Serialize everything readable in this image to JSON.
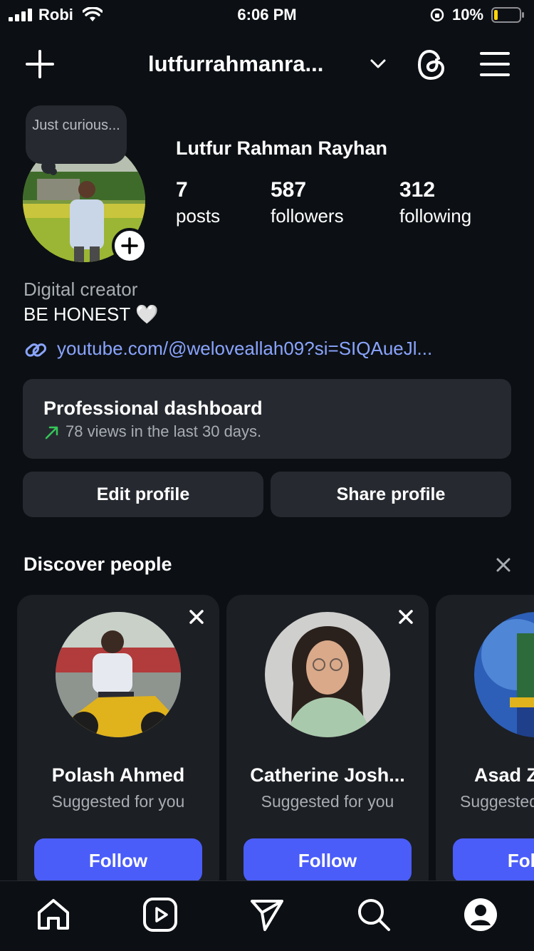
{
  "status_bar": {
    "carrier": "Robi",
    "time": "6:06 PM",
    "battery": "10%"
  },
  "header": {
    "username": "lutfurrahmanra...",
    "new_post_icon": "plus-icon",
    "threads_icon": "threads-icon",
    "menu_icon": "hamburger-menu-icon"
  },
  "profile": {
    "note": "Just curious...",
    "display_name": "Lutfur Rahman Rayhan",
    "stats": [
      {
        "value": "7",
        "label": "posts"
      },
      {
        "value": "587",
        "label": "followers"
      },
      {
        "value": "312",
        "label": "following"
      }
    ],
    "category": "Digital creator",
    "bio": "BE HONEST 🤍",
    "link": "youtube.com/@weloveallah09?si=SIQAueJl..."
  },
  "dashboard": {
    "title": "Professional dashboard",
    "subtitle": "78 views in the last 30 days."
  },
  "actions": {
    "edit": "Edit profile",
    "share": "Share profile"
  },
  "discover": {
    "title": "Discover people",
    "cards": [
      {
        "name": "Polash Ahmed",
        "sub": "Suggested for you",
        "button": "Follow"
      },
      {
        "name": "Catherine Josh...",
        "sub": "Suggested for you",
        "button": "Follow"
      },
      {
        "name": "Asad Z",
        "sub": "Suggested for you",
        "button": "Follow"
      }
    ]
  },
  "colors": {
    "background": "#0c1014",
    "card": "#262a30",
    "follow": "#4a5df9",
    "link": "#8aa4ff",
    "trend": "#35c759"
  },
  "tabs": [
    "home-icon",
    "reels-icon",
    "direct-icon",
    "search-icon",
    "profile-icon"
  ]
}
